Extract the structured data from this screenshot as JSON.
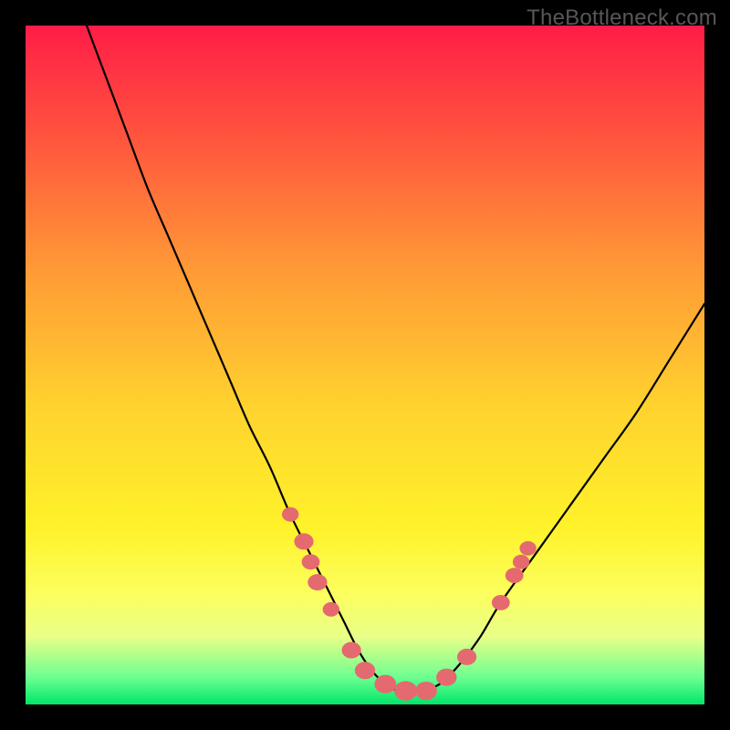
{
  "watermark": "TheBottleneck.com",
  "chart_data": {
    "type": "line",
    "title": "",
    "xlabel": "",
    "ylabel": "",
    "xlim": [
      0,
      100
    ],
    "ylim": [
      0,
      100
    ],
    "background_gradient": {
      "top": "#ff1c47",
      "bottom": "#00e66a"
    },
    "series": [
      {
        "name": "curve",
        "stroke": "#000000",
        "x": [
          9,
          12,
          15,
          18,
          21,
          24,
          27,
          30,
          33,
          36,
          39,
          42,
          45,
          47,
          49,
          51,
          53,
          55,
          58,
          61,
          64,
          67,
          70,
          75,
          80,
          85,
          90,
          95,
          100
        ],
        "y": [
          100,
          92,
          84,
          76,
          69,
          62,
          55,
          48,
          41,
          35,
          28,
          22,
          16,
          12,
          8,
          5,
          3,
          2,
          2,
          3,
          6,
          10,
          15,
          22,
          29,
          36,
          43,
          51,
          59
        ]
      }
    ],
    "markers": {
      "name": "highlight-dots",
      "fill": "#e46a6f",
      "points": [
        {
          "x": 39,
          "y": 28,
          "r": 2.8
        },
        {
          "x": 41,
          "y": 24,
          "r": 3.2
        },
        {
          "x": 42,
          "y": 21,
          "r": 3.0
        },
        {
          "x": 43,
          "y": 18,
          "r": 3.2
        },
        {
          "x": 45,
          "y": 14,
          "r": 2.8
        },
        {
          "x": 48,
          "y": 8,
          "r": 3.2
        },
        {
          "x": 50,
          "y": 5,
          "r": 3.4
        },
        {
          "x": 53,
          "y": 3,
          "r": 3.6
        },
        {
          "x": 56,
          "y": 2,
          "r": 3.8
        },
        {
          "x": 59,
          "y": 2,
          "r": 3.6
        },
        {
          "x": 62,
          "y": 4,
          "r": 3.4
        },
        {
          "x": 65,
          "y": 7,
          "r": 3.2
        },
        {
          "x": 70,
          "y": 15,
          "r": 3.0
        },
        {
          "x": 72,
          "y": 19,
          "r": 3.0
        },
        {
          "x": 73,
          "y": 21,
          "r": 2.8
        },
        {
          "x": 74,
          "y": 23,
          "r": 2.8
        }
      ]
    }
  }
}
